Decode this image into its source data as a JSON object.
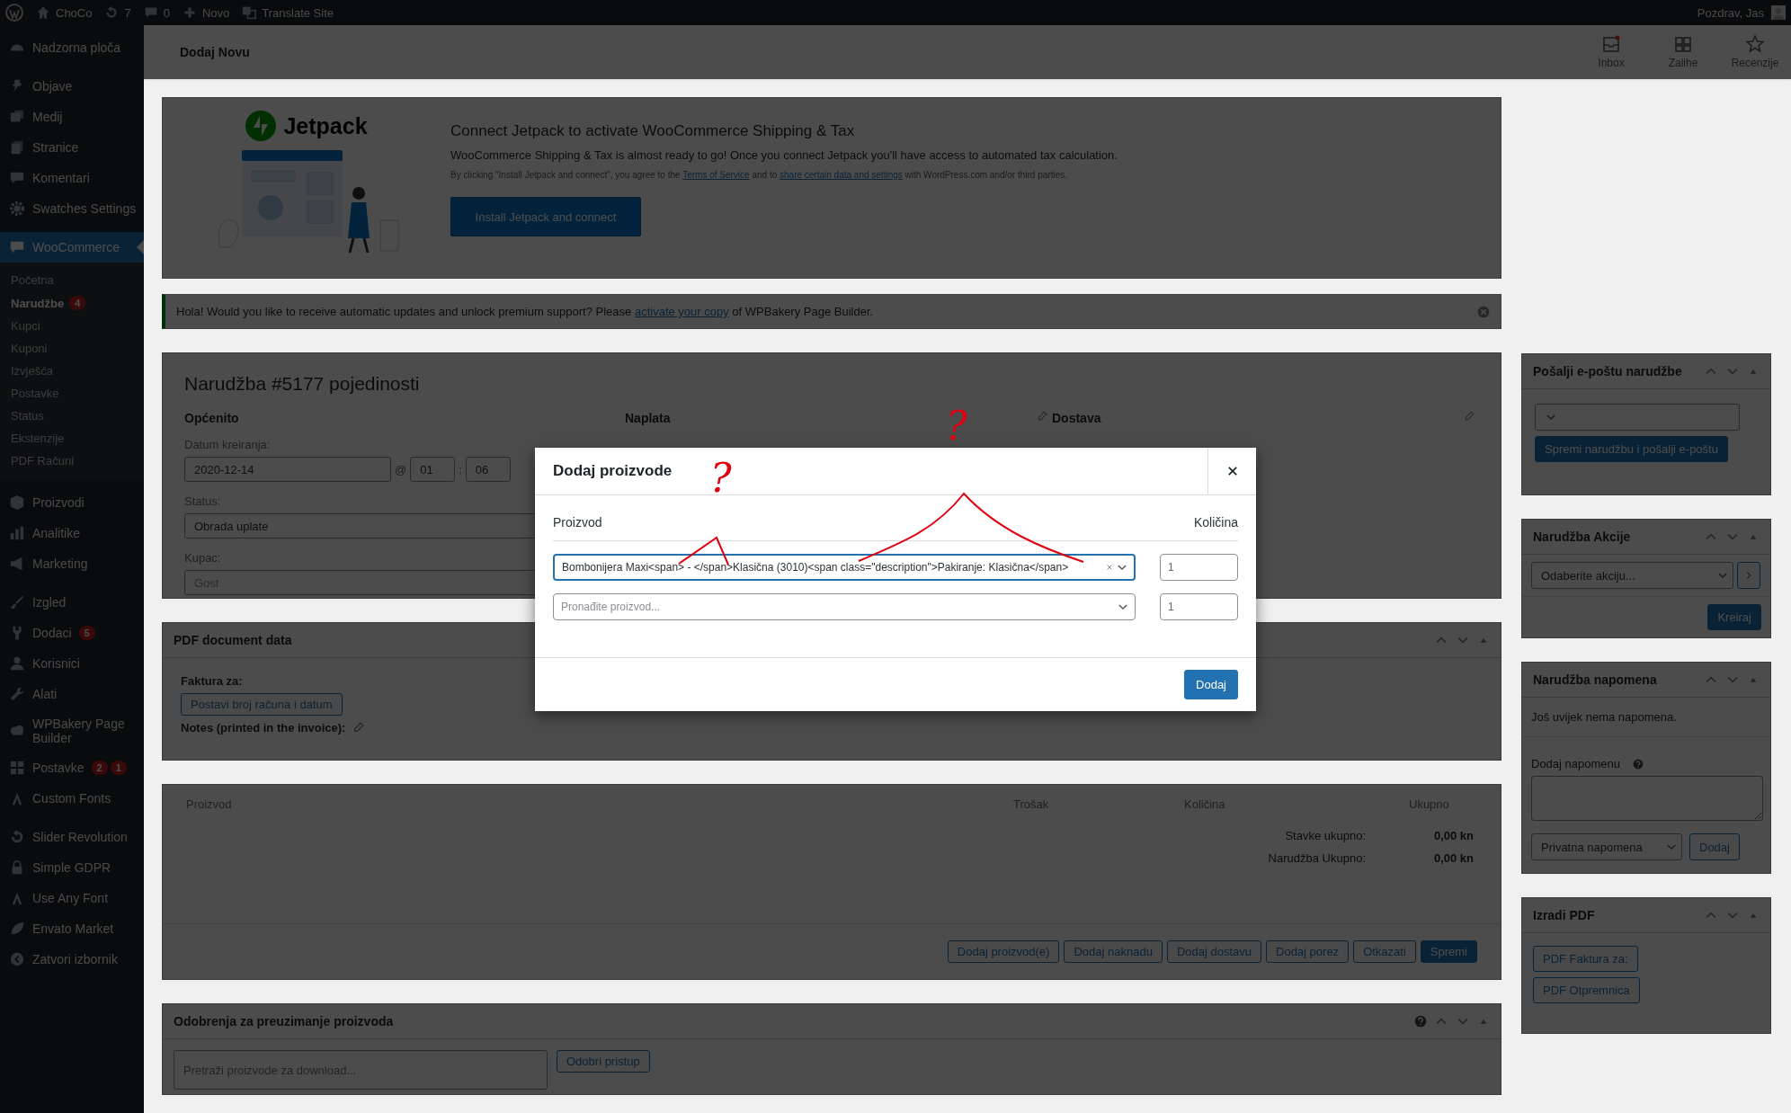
{
  "admin_bar": {
    "site": "ChoCo",
    "updates": "7",
    "comments": "0",
    "new": "Novo",
    "translate": "Translate Site",
    "greeting": "Pozdrav, Jas"
  },
  "sidebar": {
    "items": [
      {
        "label": "Nadzorna ploča",
        "selected": false
      },
      {
        "label": "Objave",
        "selected": false
      },
      {
        "label": "Medij",
        "selected": false
      },
      {
        "label": "Stranice",
        "selected": false
      },
      {
        "label": "Komentari",
        "selected": false
      },
      {
        "label": "Swatches Settings",
        "selected": false
      },
      {
        "label": "WooCommerce",
        "selected": true,
        "children": [
          {
            "label": "Početna",
            "selected": false
          },
          {
            "label": "Narudžbe",
            "selected": true,
            "badges": [
              "4"
            ]
          },
          {
            "label": "Kupci",
            "selected": false
          },
          {
            "label": "Kuponi",
            "selected": false
          },
          {
            "label": "Izvješća",
            "selected": false
          },
          {
            "label": "Postavke",
            "selected": false
          },
          {
            "label": "Status",
            "selected": false
          },
          {
            "label": "Ekstenzije",
            "selected": false
          },
          {
            "label": "PDF Računi",
            "selected": false
          }
        ]
      },
      {
        "label": "Proizvodi",
        "selected": false
      },
      {
        "label": "Analitike",
        "selected": false
      },
      {
        "label": "Marketing",
        "selected": false
      },
      {
        "label": "Izgled",
        "selected": false
      },
      {
        "label": "Dodaci",
        "selected": false,
        "badges": [
          "5"
        ]
      },
      {
        "label": "Korisnici",
        "selected": false
      },
      {
        "label": "Alati",
        "selected": false
      },
      {
        "label": "WPBakery Page Builder",
        "selected": false
      },
      {
        "label": "Postavke",
        "selected": false,
        "badges": [
          "2",
          "1"
        ]
      },
      {
        "label": "Custom Fonts",
        "selected": false
      },
      {
        "label": "Slider Revolution",
        "selected": false
      },
      {
        "label": "Simple GDPR",
        "selected": false
      },
      {
        "label": "Use Any Font",
        "selected": false
      },
      {
        "label": "Envato Market",
        "selected": false
      },
      {
        "label": "Zatvori izbornik",
        "selected": false
      }
    ]
  },
  "header": {
    "title": "Dodaj Novu",
    "actions": [
      "Inbox",
      "Zalihe",
      "Recenzije"
    ]
  },
  "jetpack": {
    "logo": "Jetpack",
    "title": "Connect Jetpack to activate WooCommerce Shipping & Tax",
    "text": "WooCommerce Shipping & Tax is almost ready to go! Once you connect Jetpack you'll have access to automated tax calculation.",
    "legal": [
      "By clicking \"Install Jetpack and connect\", you agree to the ",
      "Terms of Service",
      " and to ",
      "share certain data and settings",
      " with WordPress.com and/or third parties."
    ],
    "button": "Install Jetpack and connect"
  },
  "notice": {
    "text": [
      "Hola! Would you like to receive automatic updates and unlock premium support? Please ",
      "activate your copy",
      " of WPBakery Page Builder."
    ]
  },
  "order": {
    "title": "Narudžba #5177 pojedinosti",
    "general": {
      "heading": "Općenito",
      "date_label": "Datum kreiranja:",
      "date": "2020-12-14",
      "at": "@",
      "hour": "01",
      "sep": ":",
      "minute": "06",
      "status_label": "Status:",
      "status": "Obrada uplate",
      "customer_label": "Kupac:",
      "customer": "Gost"
    },
    "billing": {
      "heading": "Naplata"
    },
    "shipping": {
      "heading": "Dostava"
    }
  },
  "pdf_data": {
    "title": "PDF document data",
    "invoice_label": "Faktura za:",
    "button": "Postavi broj računa i datum",
    "notes_label": "Notes (printed in the invoice):"
  },
  "items": {
    "columns": [
      "Proizvod",
      "Trošak",
      "Količina",
      "Ukupno"
    ],
    "totals": [
      {
        "label": "Stavke ukupno:",
        "value": "0,00 kn"
      },
      {
        "label": "Narudžba Ukupno:",
        "value": "0,00 kn"
      }
    ],
    "buttons": [
      {
        "label": "Dodaj proizvod(e)",
        "primary": false
      },
      {
        "label": "Dodaj naknadu",
        "primary": false
      },
      {
        "label": "Dodaj dostavu",
        "primary": false
      },
      {
        "label": "Dodaj porez",
        "primary": false
      },
      {
        "label": "Otkazati",
        "primary": false
      },
      {
        "label": "Spremi",
        "primary": true
      }
    ]
  },
  "downloads": {
    "title": "Odobrenja za preuzimanje proizvoda",
    "placeholder": "Pretraži proizvode za download...",
    "button": "Odobri pristup"
  },
  "side": {
    "email": {
      "title": "Pošalji e-poštu narudžbe",
      "button": "Spremi narudžbu i pošalji e-poštu"
    },
    "actions": {
      "title": "Narudžba Akcije",
      "select": "Odaberite akciju...",
      "button": "Kreiraj"
    },
    "notes": {
      "title": "Narudžba napomena",
      "empty": "Još uvijek nema napomena.",
      "add_label": "Dodaj napomenu",
      "type": "Privatna napomena",
      "button": "Dodaj"
    },
    "pdf": {
      "title": "Izradi PDF",
      "buttons": [
        "PDF Faktura za:",
        "PDF Otpremnica"
      ]
    }
  },
  "modal": {
    "title": "Dodaj proizvode",
    "columns": [
      "Proizvod",
      "Količina"
    ],
    "rows": [
      {
        "value": "Bombonijera Maxi<span> - </span>Klasična (3010)<span class=\"description\">Pakiranje: Klasična</span>",
        "quantity": "1",
        "focused": true
      },
      {
        "placeholder": "Pronađite proizvod...",
        "quantity": "1",
        "focused": false
      }
    ],
    "button": "Dodaj"
  },
  "annotations": [
    {
      "text": "?"
    },
    {
      "text": "?"
    }
  ]
}
